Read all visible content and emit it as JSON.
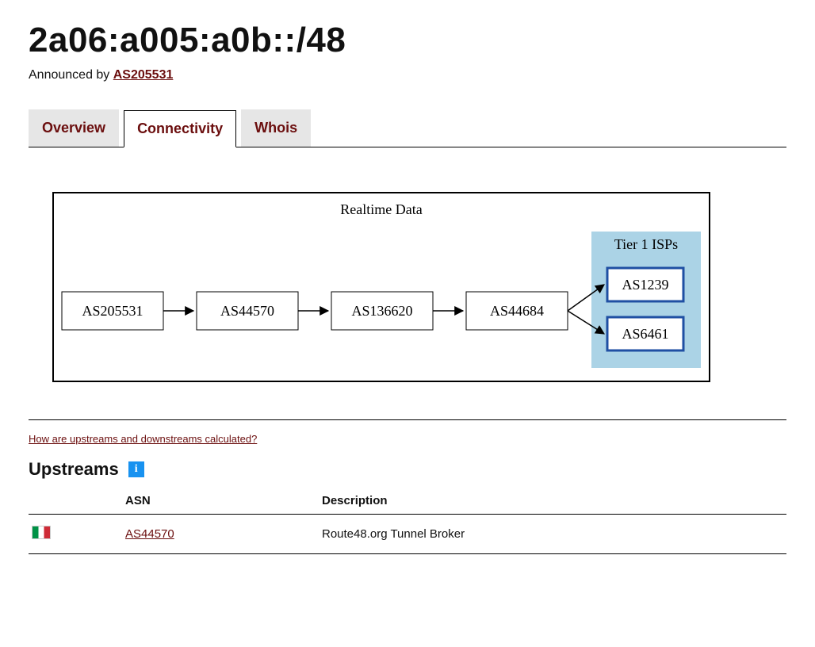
{
  "title": "2a06:a005:a0b::/48",
  "announced_label": "Announced by ",
  "announced_asn": "AS205531",
  "tabs": {
    "overview": "Overview",
    "connectivity": "Connectivity",
    "whois": "Whois"
  },
  "diagram": {
    "title": "Realtime Data",
    "tier1_label": "Tier 1 ISPs",
    "path": [
      "AS205531",
      "AS44570",
      "AS136620",
      "AS44684"
    ],
    "tier1_nodes": [
      "AS1239",
      "AS6461"
    ]
  },
  "calc_link_text": "How are upstreams and downstreams calculated?",
  "upstreams": {
    "heading": "Upstreams",
    "columns": {
      "asn": "ASN",
      "description": "Description"
    },
    "rows": [
      {
        "asn": "AS44570",
        "description": "Route48.org Tunnel Broker"
      }
    ]
  }
}
